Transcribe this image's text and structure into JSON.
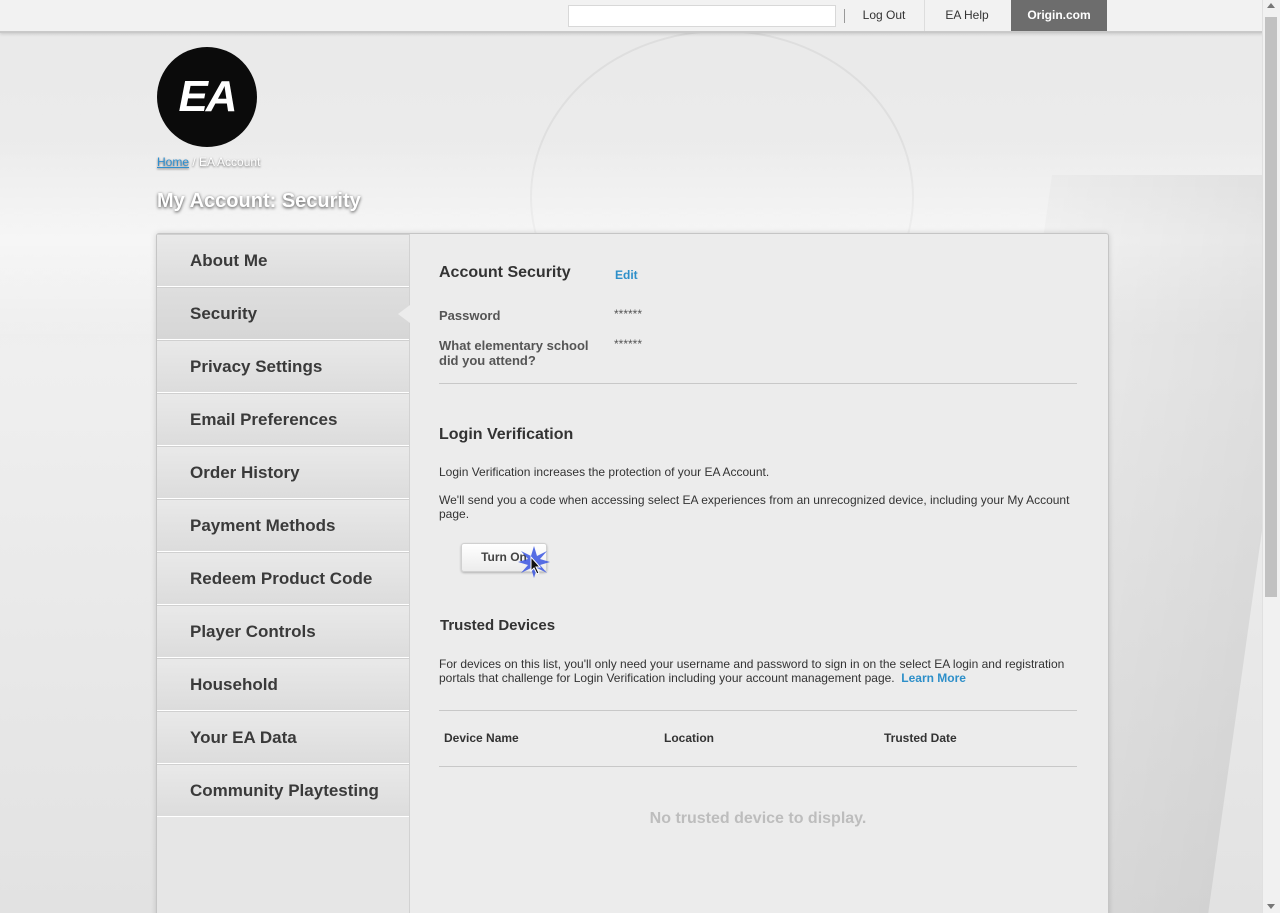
{
  "topbar": {
    "search_value": "",
    "logout_label": "Log Out",
    "help_label": "EA Help",
    "origin_label": "Origin.com"
  },
  "logo": {
    "text": "EA"
  },
  "breadcrumb": {
    "home": "Home",
    "separator": " / ",
    "current": "EA Account"
  },
  "page_title": "My Account: Security",
  "sidebar": {
    "items": [
      {
        "label": "About Me",
        "active": false
      },
      {
        "label": "Security",
        "active": true
      },
      {
        "label": "Privacy Settings",
        "active": false
      },
      {
        "label": "Email Preferences",
        "active": false
      },
      {
        "label": "Order History",
        "active": false
      },
      {
        "label": "Payment Methods",
        "active": false
      },
      {
        "label": "Redeem Product Code",
        "active": false
      },
      {
        "label": "Player Controls",
        "active": false
      },
      {
        "label": "Household",
        "active": false
      },
      {
        "label": "Your EA Data",
        "active": false
      },
      {
        "label": "Community Playtesting",
        "active": false
      }
    ]
  },
  "account_security": {
    "title": "Account Security",
    "edit_label": "Edit",
    "password_label": "Password",
    "password_value": "******",
    "question_label": "What elementary school did you attend?",
    "question_value": "******"
  },
  "login_verification": {
    "title": "Login Verification",
    "desc1": "Login Verification increases the protection of your EA Account.",
    "desc2": "We'll send you a code when accessing select EA experiences from an unrecognized device, including your My Account page.",
    "button_label": "Turn On"
  },
  "trusted_devices": {
    "title": "Trusted Devices",
    "desc": "For devices on this list, you'll only need your username and password to sign in on the select EA login and registration portals that challenge for Login Verification including your account management page.",
    "learn_more": "Learn More",
    "columns": [
      "Device Name",
      "Location",
      "Trusted Date"
    ],
    "empty_message": "No trusted device to display."
  },
  "colors": {
    "link": "#2d8fc9",
    "origin_tab": "#6d6d6d",
    "logo_bg": "#0b0b0b"
  }
}
